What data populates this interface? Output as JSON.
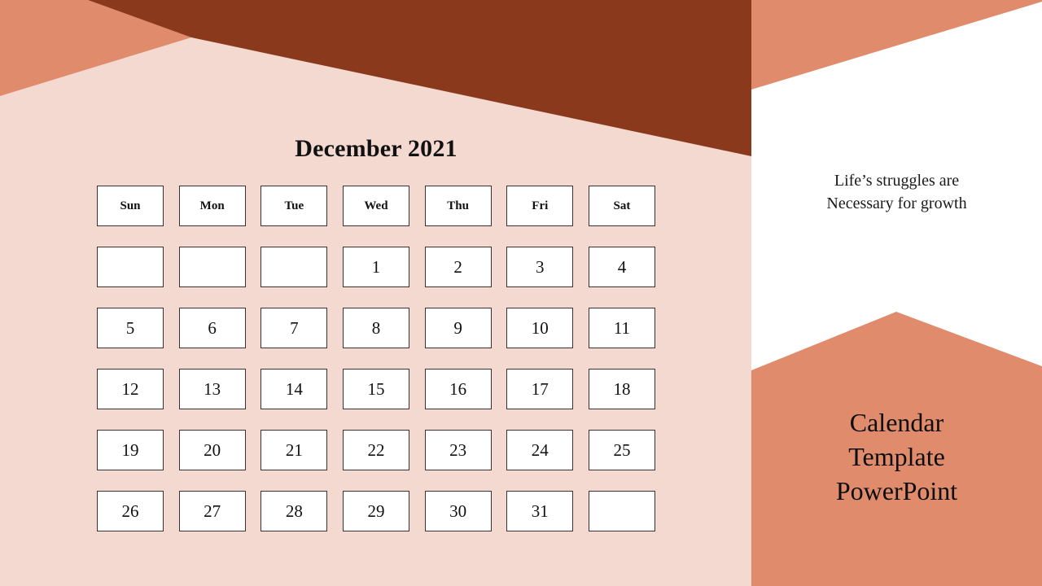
{
  "slide": {
    "colors": {
      "dark_brown": "#8A391C",
      "salmon": "#E08C6C",
      "light_pink": "#F4D9D0",
      "white": "#FFFFFF",
      "text": "#111111"
    }
  },
  "calendar": {
    "title": "December 2021",
    "weekday_headers": [
      "Sun",
      "Mon",
      "Tue",
      "Wed",
      "Thu",
      "Fri",
      "Sat"
    ],
    "weeks": [
      [
        "",
        "",
        "",
        "1",
        "2",
        "3",
        "4"
      ],
      [
        "5",
        "6",
        "7",
        "8",
        "9",
        "10",
        "11"
      ],
      [
        "12",
        "13",
        "14",
        "15",
        "16",
        "17",
        "18"
      ],
      [
        "19",
        "20",
        "21",
        "22",
        "23",
        "24",
        "25"
      ],
      [
        "26",
        "27",
        "28",
        "29",
        "30",
        "31",
        ""
      ]
    ]
  },
  "sidebar": {
    "quote": {
      "line1": "Life’s struggles are",
      "line2": "Necessary for growth"
    },
    "title": {
      "line1": "Calendar",
      "line2": "Template",
      "line3": "PowerPoint"
    }
  }
}
